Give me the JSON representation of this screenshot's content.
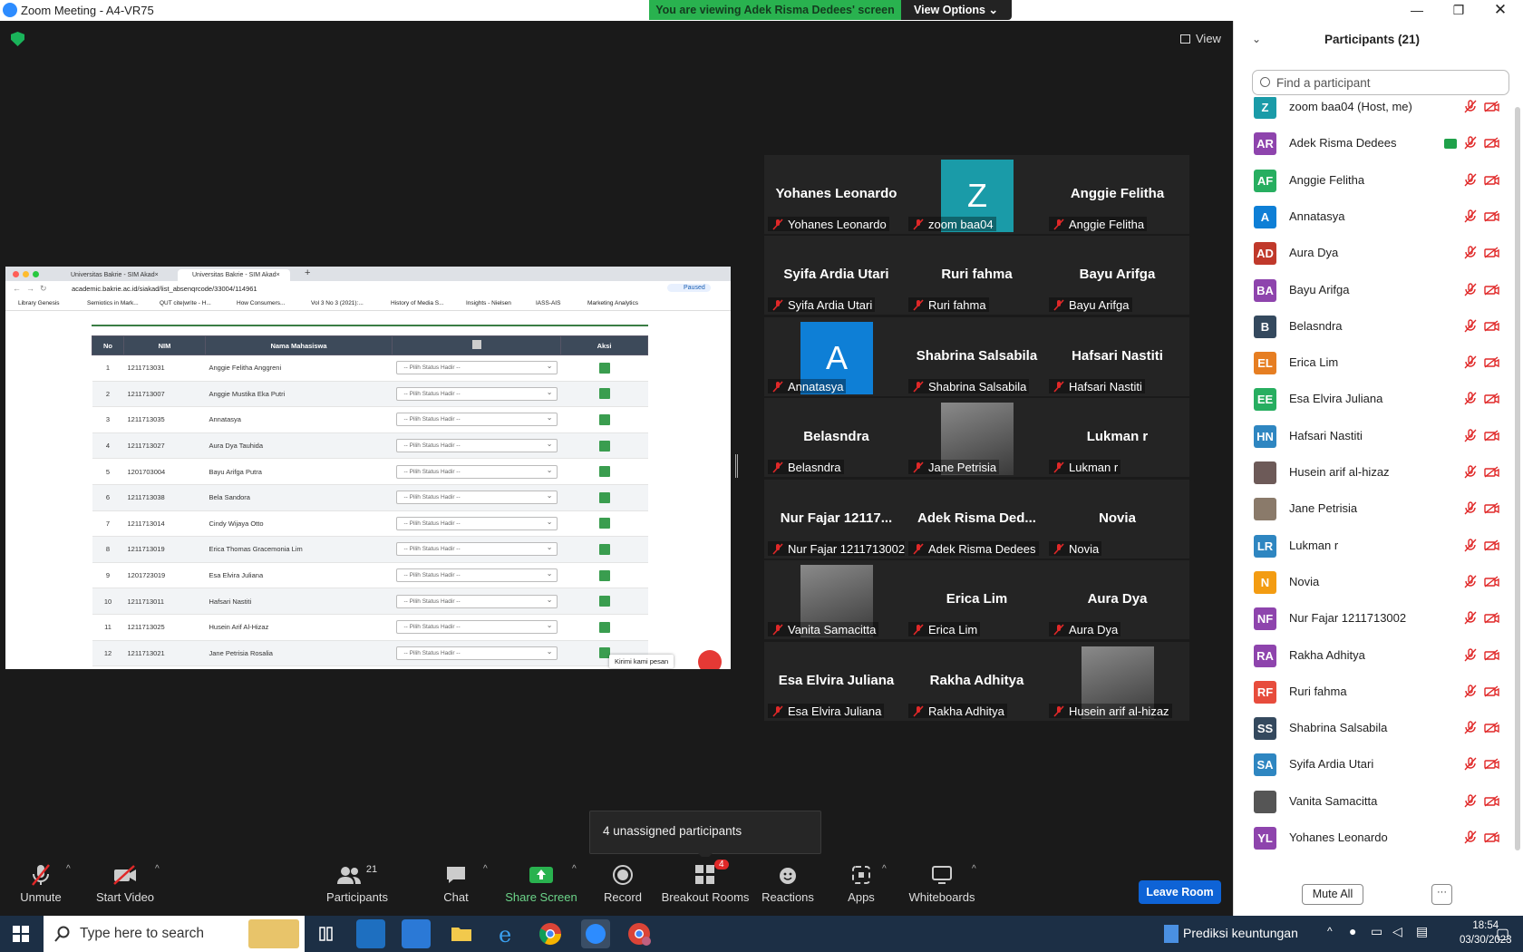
{
  "window": {
    "title": "Zoom Meeting - A4-VR75",
    "banner": "You are viewing Adek Risma Dedees' screen",
    "view_options": "View Options",
    "view_label": "View"
  },
  "browser": {
    "tabs": [
      "Universitas Bakrie - SIM Akad×",
      "Universitas Bakrie - SIM Akad×"
    ],
    "url": "academic.bakrie.ac.id/siakad/list_absenqrcode/33004/114961",
    "paused": "Paused",
    "bookmarks": [
      "Library Genesis",
      "Semiotics in Mark...",
      "QUT cite|write - H...",
      "How Consumers...",
      "Vol 3 No 3 (2021):...",
      "History of Media S...",
      "Insights - Nielsen",
      "IASS-AIS",
      "Marketing Analytics"
    ]
  },
  "attendance": {
    "headers": [
      "No",
      "NIM",
      "Nama Mahasiswa",
      "",
      "Aksi"
    ],
    "select_placeholder": "-- Pilih Status Hadir --",
    "rows": [
      [
        "1",
        "1211713031",
        "Anggie Felitha Anggreni"
      ],
      [
        "2",
        "1211713007",
        "Anggie Mustika Eka Putri"
      ],
      [
        "3",
        "1211713035",
        "Annatasya"
      ],
      [
        "4",
        "1211713027",
        "Aura Dya Tauhida"
      ],
      [
        "5",
        "1201703004",
        "Bayu Arifga Putra"
      ],
      [
        "6",
        "1211713038",
        "Bela Sandora"
      ],
      [
        "7",
        "1211713014",
        "Cindy Wijaya Otto"
      ],
      [
        "8",
        "1211713019",
        "Erica Thomas Gracemonia Lim"
      ],
      [
        "9",
        "1201723019",
        "Esa Elvira Juliana"
      ],
      [
        "10",
        "1211713011",
        "Hafsari Nastiti"
      ],
      [
        "11",
        "1211713025",
        "Husein Arif Al-Hizaz"
      ],
      [
        "12",
        "1211713021",
        "Jane Petrisia Rosalia"
      ]
    ],
    "chat_tip": "Kirimi kami pesan"
  },
  "gallery": [
    {
      "big": "Yohanes Leonardo",
      "name": "Yohanes Leonardo"
    },
    {
      "avatar": "Z",
      "avatar_color": "#1a9ba8",
      "name": "zoom baa04"
    },
    {
      "big": "Anggie Felitha",
      "name": "Anggie Felitha"
    },
    {
      "big": "Syifa Ardia Utari",
      "name": "Syifa Ardia Utari"
    },
    {
      "big": "Ruri fahma",
      "name": "Ruri fahma"
    },
    {
      "big": "Bayu Arifga",
      "name": "Bayu Arifga"
    },
    {
      "avatar": "A",
      "avatar_color": "#0e7fd6",
      "name": "Annatasya"
    },
    {
      "big": "Shabrina Salsabila",
      "name": "Shabrina Salsabila"
    },
    {
      "big": "Hafsari Nastiti",
      "name": "Hafsari Nastiti"
    },
    {
      "big": "Belasndra",
      "name": "Belasndra"
    },
    {
      "photo": "person-photo",
      "name": "Jane Petrisia"
    },
    {
      "big": "Lukman r",
      "name": "Lukman r"
    },
    {
      "big": "Nur Fajar 12117...",
      "name": "Nur Fajar 1211713002"
    },
    {
      "big": "Adek Risma Ded...",
      "name": "Adek Risma Dedees"
    },
    {
      "big": "Novia",
      "name": "Novia"
    },
    {
      "photo": "person-photo",
      "name": "Vanita Samacitta"
    },
    {
      "big": "Erica Lim",
      "name": "Erica Lim"
    },
    {
      "big": "Aura Dya",
      "name": "Aura Dya"
    },
    {
      "big": "Esa Elvira Juliana",
      "name": "Esa Elvira Juliana"
    },
    {
      "big": "Rakha Adhitya",
      "name": "Rakha Adhitya"
    },
    {
      "photo": "person-photo",
      "name": "Husein arif al-hizaz"
    }
  ],
  "unassigned": "4 unassigned participants",
  "toolbar": {
    "unmute": "Unmute",
    "start_video": "Start Video",
    "participants": "Participants",
    "participants_count": "21",
    "chat": "Chat",
    "share_screen": "Share Screen",
    "record": "Record",
    "breakout": "Breakout Rooms",
    "breakout_badge": "4",
    "reactions": "Reactions",
    "apps": "Apps",
    "whiteboards": "Whiteboards",
    "leave": "Leave Room"
  },
  "panel": {
    "title": "Participants (21)",
    "search_placeholder": "Find a participant",
    "mute_all": "Mute All",
    "more": "···",
    "participants": [
      {
        "initials": "Z",
        "color": "#1a9ba8",
        "name": "zoom baa04 (Host, me)"
      },
      {
        "initials": "AR",
        "color": "#8e44ad",
        "name": "Adek Risma Dedees",
        "sharing": true
      },
      {
        "initials": "AF",
        "color": "#27ae60",
        "name": "Anggie Felitha"
      },
      {
        "initials": "A",
        "color": "#0e7fd6",
        "name": "Annatasya"
      },
      {
        "initials": "AD",
        "color": "#c0392b",
        "name": "Aura Dya"
      },
      {
        "initials": "BA",
        "color": "#8e44ad",
        "name": "Bayu Arifga"
      },
      {
        "initials": "B",
        "color": "#34495e",
        "name": "Belasndra"
      },
      {
        "initials": "EL",
        "color": "#e67e22",
        "name": "Erica Lim"
      },
      {
        "initials": "EE",
        "color": "#27ae60",
        "name": "Esa Elvira Juliana"
      },
      {
        "initials": "HN",
        "color": "#2e86c1",
        "name": "Hafsari Nastiti"
      },
      {
        "initials": "",
        "color": "#6d5a58",
        "name": "Husein arif al-hizaz",
        "photo": true
      },
      {
        "initials": "",
        "color": "#8a7a6a",
        "name": "Jane Petrisia",
        "photo": true
      },
      {
        "initials": "LR",
        "color": "#2e86c1",
        "name": "Lukman r"
      },
      {
        "initials": "N",
        "color": "#f39c12",
        "name": "Novia"
      },
      {
        "initials": "NF",
        "color": "#8e44ad",
        "name": "Nur Fajar 1211713002"
      },
      {
        "initials": "RA",
        "color": "#8e44ad",
        "name": "Rakha Adhitya"
      },
      {
        "initials": "RF",
        "color": "#e74c3c",
        "name": "Ruri fahma"
      },
      {
        "initials": "SS",
        "color": "#34495e",
        "name": "Shabrina Salsabila"
      },
      {
        "initials": "SA",
        "color": "#2e86c1",
        "name": "Syifa Ardia Utari"
      },
      {
        "initials": "",
        "color": "#555555",
        "name": "Vanita Samacitta",
        "photo": true
      },
      {
        "initials": "YL",
        "color": "#8e44ad",
        "name": "Yohanes Leonardo"
      }
    ]
  },
  "taskbar": {
    "search_placeholder": "Type here to search",
    "news": "Prediksi keuntungan",
    "time": "18:54",
    "date": "03/30/2023"
  }
}
